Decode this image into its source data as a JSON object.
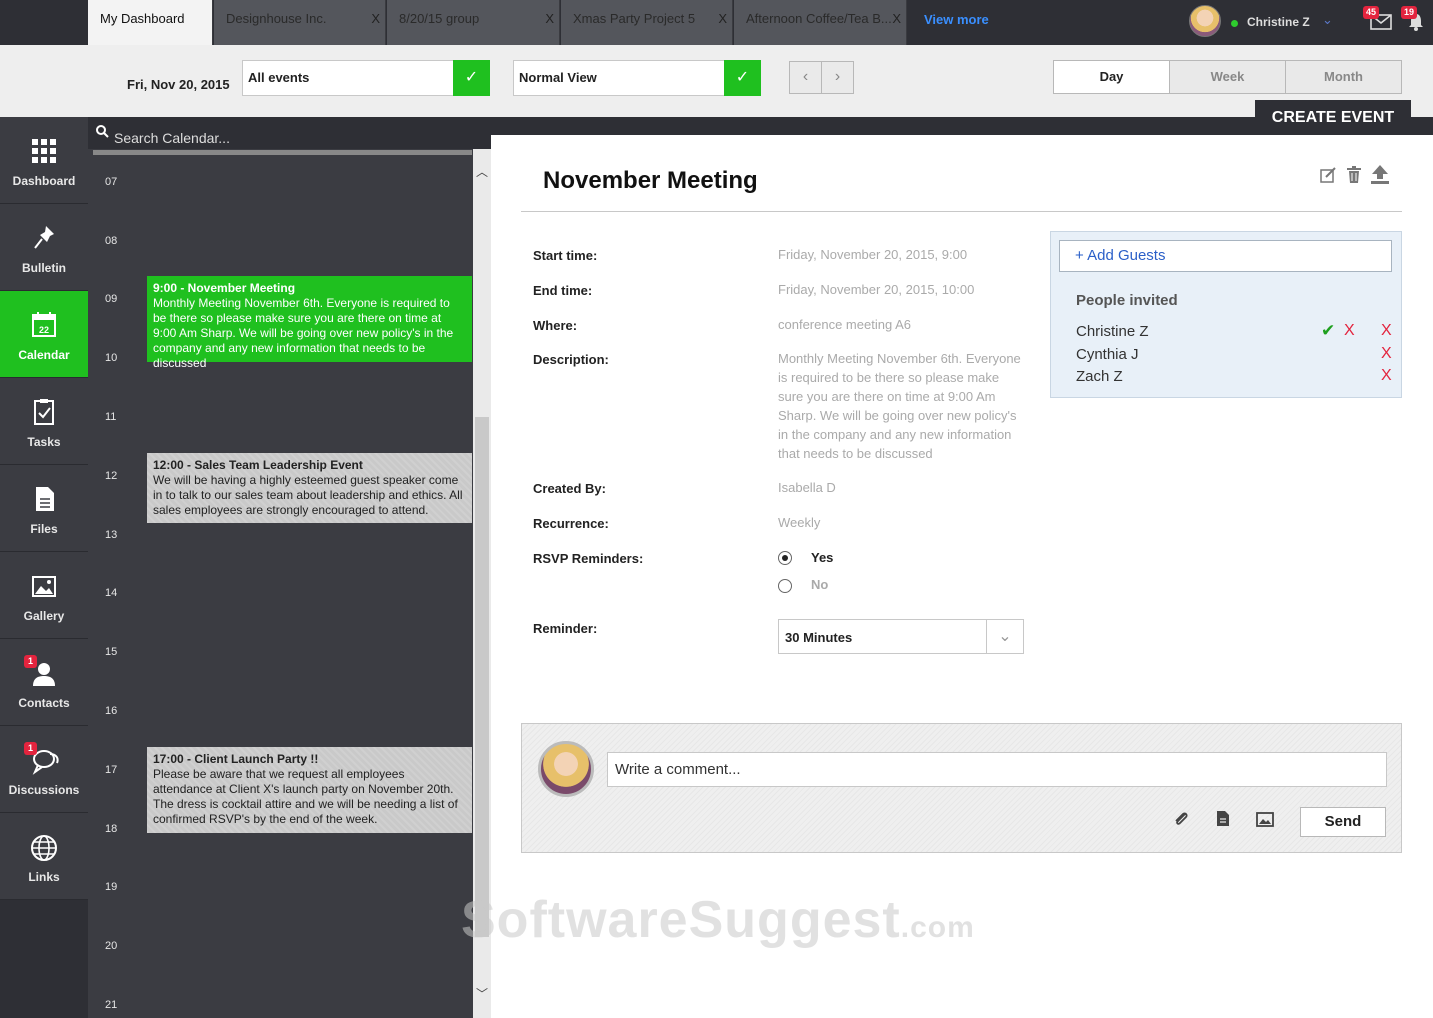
{
  "tabs": [
    {
      "label": "My Dashboard",
      "active": true,
      "closable": false
    },
    {
      "label": "Designhouse Inc.",
      "active": false,
      "closable": true
    },
    {
      "label": "8/20/15 group",
      "active": false,
      "closable": true
    },
    {
      "label": "Xmas Party Project 5",
      "active": false,
      "closable": true
    },
    {
      "label": "Afternoon Coffee/Tea B...",
      "active": false,
      "closable": true
    }
  ],
  "tab_close_label": "X",
  "view_more": "View more",
  "user": {
    "name": "Christine Z",
    "status_color": "#2ecc2e"
  },
  "notifications": {
    "messages_count": "45",
    "alerts_count": "19"
  },
  "toolbar": {
    "date": "Fri, Nov 20, 2015",
    "events_filter": "All events",
    "view_mode": "Normal View",
    "views": [
      "Day",
      "Week",
      "Month"
    ],
    "active_view": "Day",
    "create_event": "CREATE EVENT"
  },
  "sidebar": [
    {
      "label": "Dashboard",
      "icon": "grid-icon",
      "active": false
    },
    {
      "label": "Bulletin",
      "icon": "pin-icon",
      "active": false
    },
    {
      "label": "Calendar",
      "icon": "calendar-icon",
      "active": true,
      "icon_text": "22"
    },
    {
      "label": "Tasks",
      "icon": "clipboard-icon",
      "active": false
    },
    {
      "label": "Files",
      "icon": "file-icon",
      "active": false
    },
    {
      "label": "Gallery",
      "icon": "image-icon",
      "active": false
    },
    {
      "label": "Contacts",
      "icon": "person-icon",
      "active": false,
      "badge": "1"
    },
    {
      "label": "Discussions",
      "icon": "chat-icon",
      "active": false,
      "badge": "1"
    },
    {
      "label": "Links",
      "icon": "globe-icon",
      "active": false
    }
  ],
  "calendar": {
    "search_placeholder": "Search Calendar...",
    "hours": [
      "07",
      "08",
      "09",
      "10",
      "11",
      "12",
      "13",
      "14",
      "15",
      "16",
      "17",
      "18",
      "19",
      "20",
      "21"
    ],
    "events": [
      {
        "title": "9:00 - November Meeting",
        "body": "Monthly Meeting November 6th. Everyone is required to be there so please make sure you are there on time at 9:00 Am Sharp. We will be going over new policy's in the company and any new information that needs to be discussed",
        "color": "green"
      },
      {
        "title": "12:00 - Sales Team Leadership Event",
        "body": "We will be having a highly esteemed guest speaker come in to talk to our sales team about leadership and ethics. All sales employees are strongly encouraged to attend.",
        "color": "grey"
      },
      {
        "title": "17:00 - Client Launch Party !!",
        "body": "Please be aware that we request all employees attendance at Client X's launch party on November 20th. The dress is cocktail attire and we will be needing a list of confirmed RSVP's by the end of the week.",
        "color": "grey"
      }
    ]
  },
  "detail": {
    "title": "November Meeting",
    "labels": {
      "start": "Start time:",
      "end": "End time:",
      "where": "Where:",
      "description": "Description:",
      "created_by": "Created By:",
      "recurrence": "Recurrence:",
      "rsvp": "RSVP Reminders:",
      "reminder": "Reminder:"
    },
    "start": "Friday, November 20, 2015, 9:00",
    "end": "Friday, November 20, 2015, 10:00",
    "where": "conference meeting A6",
    "description": "Monthly Meeting November 6th. Everyone is required to be there so please make sure you are there on time at 9:00 Am Sharp. We will be going over new policy's in the company and any new information that needs to be discussed",
    "created_by": "Isabella D",
    "recurrence": "Weekly",
    "rsvp_options": [
      "Yes",
      "No"
    ],
    "rsvp_selected": "Yes",
    "reminder": "30 Minutes"
  },
  "guests": {
    "add_label": "+ Add Guests",
    "title": "People invited",
    "people": [
      "Christine Z",
      "Cynthia J",
      "Zach Z"
    ],
    "remove_label": "X",
    "accepted_mark": "✔"
  },
  "comment": {
    "placeholder": "Write a comment...",
    "send": "Send"
  },
  "watermark": {
    "main": "SoftwareSuggest",
    "suffix": ".com"
  },
  "colors": {
    "accent": "#1fc01f",
    "dark": "#2e2f35",
    "badge": "#e3243e",
    "link": "#2a5fc8"
  }
}
